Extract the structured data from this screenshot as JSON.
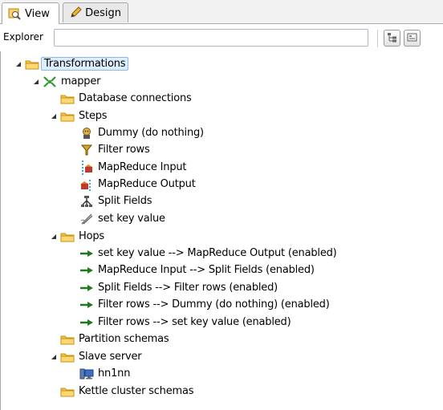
{
  "tabs": [
    {
      "label": "View",
      "icon": "view-icon",
      "active": true
    },
    {
      "label": "Design",
      "icon": "pencil-icon",
      "active": false
    }
  ],
  "explorer": {
    "label": "Explorer",
    "search_value": "",
    "search_placeholder": ""
  },
  "toolbar": {
    "buttons": [
      "expand-tree-icon",
      "collapse-tree-icon"
    ]
  },
  "tree": {
    "root": "Transformations",
    "transformation": "mapper",
    "database_connections": "Database connections",
    "steps": {
      "label": "Steps",
      "items": [
        "Dummy (do nothing)",
        "Filter rows",
        "MapReduce Input",
        "MapReduce Output",
        "Split Fields",
        "set key value"
      ]
    },
    "hops": {
      "label": "Hops",
      "items": [
        "set key value --> MapReduce Output (enabled)",
        "MapReduce Input --> Split Fields (enabled)",
        "Split Fields --> Filter rows (enabled)",
        "Filter rows --> Dummy (do nothing) (enabled)",
        "Filter rows --> set key value (enabled)"
      ]
    },
    "partition_schemas": "Partition schemas",
    "slave_server": {
      "label": "Slave server",
      "items": [
        "hn1nn"
      ]
    },
    "kettle_cluster_schemas": "Kettle cluster schemas"
  },
  "colors": {
    "folder": "#f7c443",
    "hop_arrow": "#1f7a1f",
    "selection": "#dceeff"
  }
}
